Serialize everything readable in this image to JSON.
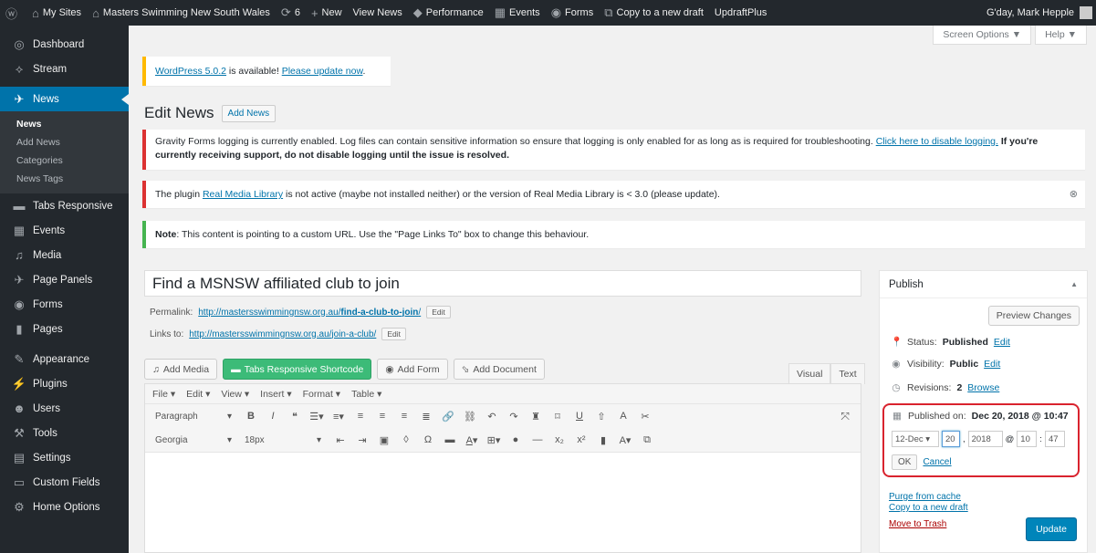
{
  "adminbar": {
    "wp_icon": "wordpress-icon",
    "my_sites": "My Sites",
    "site_name": "Masters Swimming New South Wales",
    "updates_count": "6",
    "new_label": "New",
    "view_news": "View News",
    "performance": "Performance",
    "events": "Events",
    "forms": "Forms",
    "copy_draft": "Copy to a new draft",
    "updraft": "UpdraftPlus",
    "greeting": "G'day, Mark Hepple"
  },
  "sidebar": {
    "items": [
      {
        "label": "Dashboard",
        "icon": "dashboard-icon"
      },
      {
        "label": "Stream",
        "icon": "stream-icon"
      },
      {
        "label": "News",
        "icon": "pin-icon"
      },
      {
        "label": "Tabs Responsive",
        "icon": "folder-icon"
      },
      {
        "label": "Events",
        "icon": "calendar-icon"
      },
      {
        "label": "Media",
        "icon": "media-icon"
      },
      {
        "label": "Page Panels",
        "icon": "pin-icon"
      },
      {
        "label": "Forms",
        "icon": "forms-icon"
      },
      {
        "label": "Pages",
        "icon": "pages-icon"
      },
      {
        "label": "Appearance",
        "icon": "brush-icon"
      },
      {
        "label": "Plugins",
        "icon": "plugin-icon"
      },
      {
        "label": "Users",
        "icon": "users-icon"
      },
      {
        "label": "Tools",
        "icon": "wrench-icon"
      },
      {
        "label": "Settings",
        "icon": "settings-icon"
      },
      {
        "label": "Custom Fields",
        "icon": "fields-icon"
      },
      {
        "label": "Home Options",
        "icon": "gear-icon"
      }
    ],
    "submenu": [
      "News",
      "Add News",
      "Categories",
      "News Tags"
    ]
  },
  "screen_options": {
    "screen": "Screen Options ▼",
    "help": "Help ▼"
  },
  "notices": {
    "update_link": "WordPress 5.0.2",
    "update_mid": " is available! ",
    "update_link2": "Please update now",
    "update_end": ".",
    "gravity_text": "Gravity Forms logging is currently enabled. Log files can contain sensitive information so ensure that logging is only enabled for as long as is required for troubleshooting. ",
    "gravity_link": "Click here to disable logging.",
    "gravity_bold": " If you're currently receiving support, do not disable logging until the issue is resolved.",
    "plugin_pre": "The plugin ",
    "plugin_link": "Real Media Library",
    "plugin_post": " is not active (maybe not installed neither) or the version of Real Media Library is < 3.0 (please update).",
    "note_bold": "Note",
    "note_text": ": This content is pointing to a custom URL. Use the \"Page Links To\" box to change this behaviour."
  },
  "page": {
    "title": "Edit News",
    "add_new": "Add News"
  },
  "post": {
    "title": "Find a MSNSW affiliated club to join",
    "permalink_label": "Permalink:",
    "permalink_base": "http://mastersswimmingnsw.org.au/",
    "permalink_slug": "find-a-club-to-join",
    "permalink_end": "/",
    "links_to_label": "Links to:",
    "links_to_url": "http://mastersswimmingnsw.org.au/join-a-club/",
    "edit": "Edit"
  },
  "media_buttons": {
    "add_media": "Add Media",
    "tabs_shortcode": "Tabs Responsive Shortcode",
    "add_form": "Add Form",
    "add_document": "Add Document"
  },
  "editor_tabs": {
    "visual": "Visual",
    "text": "Text"
  },
  "editor": {
    "menus": [
      "File ▾",
      "Edit ▾",
      "View ▾",
      "Insert ▾",
      "Format ▾",
      "Table ▾"
    ],
    "paragraph": "Paragraph",
    "font": "Georgia",
    "size": "18px"
  },
  "publish": {
    "heading": "Publish",
    "preview": "Preview Changes",
    "status_label": "Status:",
    "status_value": "Published",
    "visibility_label": "Visibility:",
    "visibility_value": "Public",
    "revisions_label": "Revisions:",
    "revisions_value": "2",
    "browse": "Browse",
    "edit": "Edit",
    "published_label": "Published on:",
    "published_value": "Dec 20, 2018 @ 10:47",
    "month": "12-Dec",
    "day": "20",
    "year": "2018",
    "at": "@",
    "hour": "10",
    "minute": "47",
    "ok": "OK",
    "cancel": "Cancel",
    "purge": "Purge from cache",
    "copy_draft": "Copy to a new draft",
    "trash": "Move to Trash",
    "update": "Update"
  },
  "colors": {
    "accent": "#0073aa",
    "error_border": "#dc3232",
    "warning_border": "#ffb900",
    "success_border": "#46b450",
    "highlight": "#d9232e"
  }
}
